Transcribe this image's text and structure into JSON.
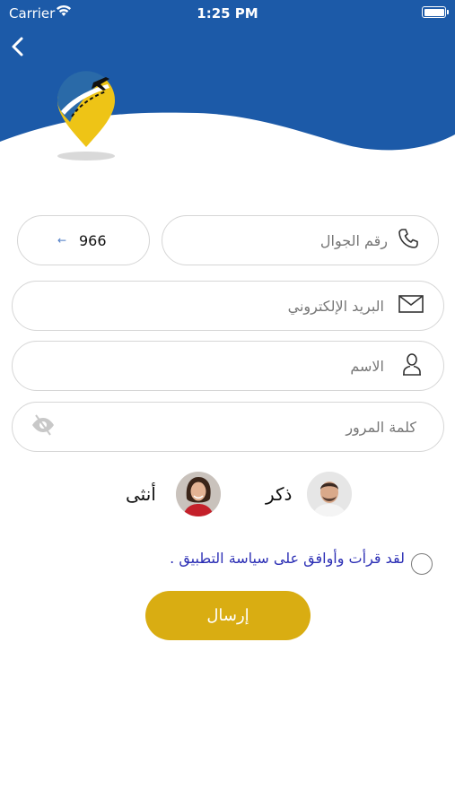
{
  "status_bar": {
    "carrier": "Carrier",
    "time": "1:25 PM"
  },
  "colors": {
    "header_blue": "#1c5aa8",
    "accent_gold": "#d9ad12",
    "link_blue": "#2c2fb5"
  },
  "icons": {
    "back": "chevron-left-icon",
    "phone": "phone-icon",
    "email": "envelope-icon",
    "name": "user-icon",
    "password": "eye-slash-icon",
    "code_arrow": "arrow-left-icon"
  },
  "form": {
    "phone_placeholder": "رقم الجوال",
    "country_code": "966",
    "email_placeholder": "البريد الإلكتروني",
    "name_placeholder": "الاسم",
    "password_placeholder": "كلمة المرور"
  },
  "gender": {
    "male_label": "ذكر",
    "female_label": "أنثى"
  },
  "terms": {
    "text": "لقد قرأت وأوافق على سياسة التطبيق ."
  },
  "submit": {
    "label": "إرسال"
  }
}
